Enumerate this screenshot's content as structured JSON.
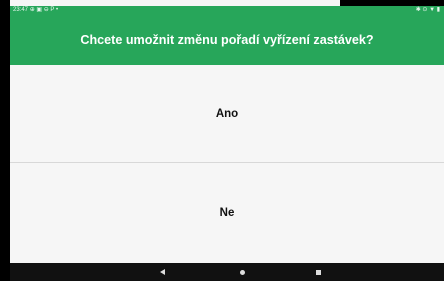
{
  "status_bar": {
    "time": "23:47",
    "left_icons": "⊕ ▣ ⊖ P •",
    "right_icons": "✱ ⊙ ▼ ▮"
  },
  "dialog": {
    "question": "Chcete umožnit změnu pořadí vyřízení zastávek?",
    "yes_label": "Ano",
    "no_label": "Ne"
  },
  "colors": {
    "header": "#27a65a",
    "background": "#f6f6f6",
    "nav_bar": "#111111"
  },
  "nav_icons": [
    "back-icon",
    "home-icon",
    "recents-icon"
  ]
}
